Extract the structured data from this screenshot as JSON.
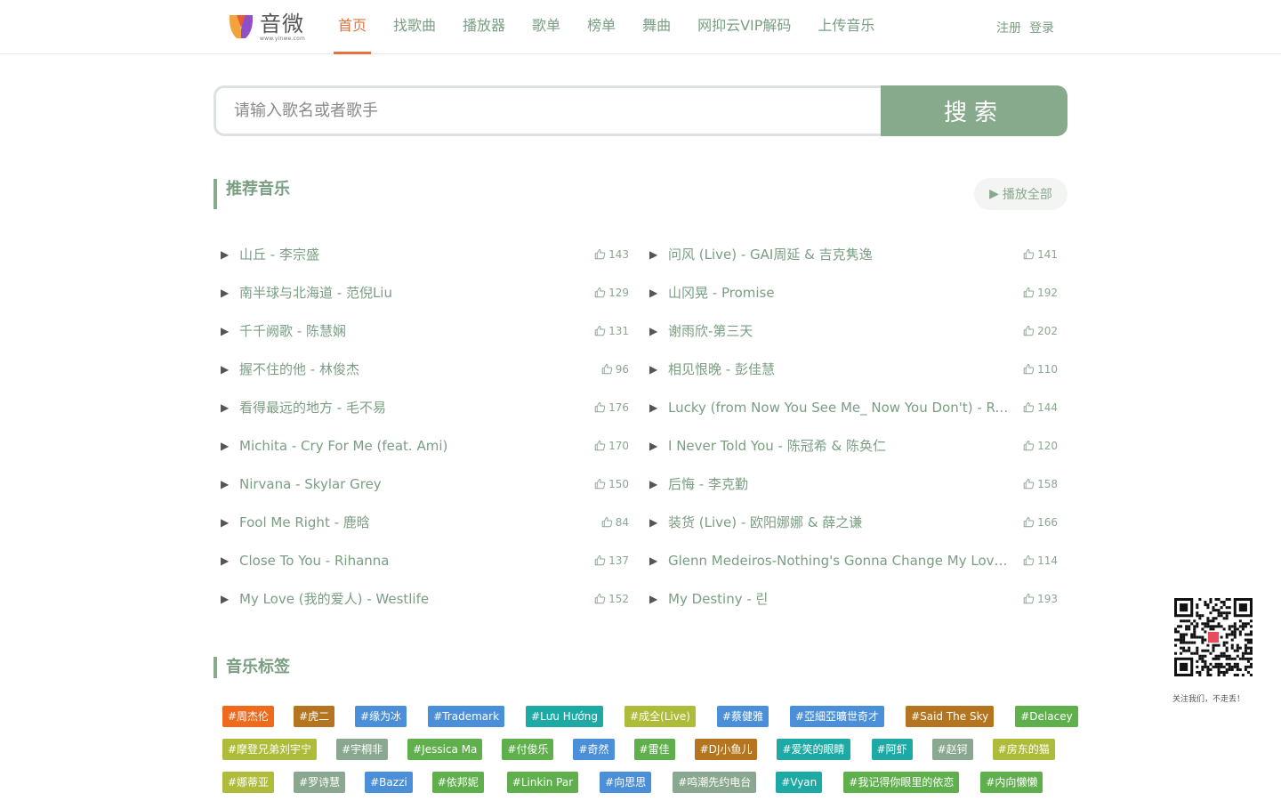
{
  "header": {
    "logo_text": "音微",
    "logo_sub": "www.yinwe.com",
    "nav": [
      {
        "label": "首页",
        "active": true
      },
      {
        "label": "找歌曲",
        "active": false
      },
      {
        "label": "播放器",
        "active": false
      },
      {
        "label": "歌单",
        "active": false
      },
      {
        "label": "榜单",
        "active": false
      },
      {
        "label": "舞曲",
        "active": false
      },
      {
        "label": "网抑云VIP解码",
        "active": false
      },
      {
        "label": "上传音乐",
        "active": false
      }
    ],
    "register": "注册",
    "login": "登录"
  },
  "search": {
    "placeholder": "请输入歌名或者歌手",
    "button": "搜索"
  },
  "recommend": {
    "title": "推荐音乐",
    "play_all": "播放全部",
    "left": [
      {
        "name": "山丘 - 李宗盛",
        "likes": "143"
      },
      {
        "name": "南半球与北海道 - 范倪Liu",
        "likes": "129"
      },
      {
        "name": "千千阙歌 - 陈慧娴",
        "likes": "131"
      },
      {
        "name": "握不住的他 - 林俊杰",
        "likes": "96"
      },
      {
        "name": "看得最远的地方 - 毛不易",
        "likes": "176"
      },
      {
        "name": "Michita - Cry For Me (feat. Ami)",
        "likes": "170"
      },
      {
        "name": "Nirvana - Skylar Grey",
        "likes": "150"
      },
      {
        "name": "Fool Me Right - 鹿晗",
        "likes": "84"
      },
      {
        "name": "Close To You - Rihanna",
        "likes": "137"
      },
      {
        "name": "My Love (我的爱人) - Westlife",
        "likes": "152"
      }
    ],
    "right": [
      {
        "name": "问风 (Live) - GAI周延 & 吉克隽逸",
        "likes": "141"
      },
      {
        "name": "山冈晃 - Promise",
        "likes": "192"
      },
      {
        "name": "谢雨欣-第三天",
        "likes": "202"
      },
      {
        "name": "相见恨晚 - 彭佳慧",
        "likes": "110"
      },
      {
        "name": "Lucky (from Now You See Me_ Now You Don't) - Reneé ...",
        "likes": "144"
      },
      {
        "name": "I Never Told You - 陈冠希 & 陈奂仁",
        "likes": "120"
      },
      {
        "name": "后悔 - 李克勤",
        "likes": "158"
      },
      {
        "name": "装货 (Live) - 欧阳娜娜 & 薛之谦",
        "likes": "166"
      },
      {
        "name": "Glenn Medeiros-Nothing's Gonna Change My Love For Y...",
        "likes": "114"
      },
      {
        "name": "My Destiny - 린",
        "likes": "193"
      }
    ]
  },
  "tags": {
    "title": "音乐标签",
    "rows": [
      [
        {
          "label": "#周杰伦",
          "color": "#f06a1d",
          "gap": 0
        },
        {
          "label": "#虎二",
          "color": "#b5741f",
          "gap": 22
        },
        {
          "label": "#缘为冰",
          "color": "#4a8fd8",
          "gap": 23
        },
        {
          "label": "#Trademark",
          "color": "#4a8fd8",
          "gap": 24
        },
        {
          "label": "#Lưu Hướng",
          "color": "#1eaaa4",
          "gap": 24
        },
        {
          "label": "#成全(Live)",
          "color": "#aebc3a",
          "gap": 24
        },
        {
          "label": "#蔡健雅",
          "color": "#4a8fd8",
          "gap": 24
        },
        {
          "label": "#亞細亞曠世奇才",
          "color": "#4a8fd8",
          "gap": 24
        },
        {
          "label": "#Said The Sky",
          "color": "#b5741f",
          "gap": 24
        },
        {
          "label": "#Delacey",
          "color": "#5fb04d",
          "gap": 24
        }
      ],
      [
        {
          "label": "#摩登兄弟刘宇宁",
          "color": "#aebc3a",
          "gap": 0
        },
        {
          "label": "#宇桐非",
          "color": "#8aa88f",
          "gap": 22
        },
        {
          "label": "#Jessica Ma",
          "color": "#5fb04d",
          "gap": 22
        },
        {
          "label": "#付俊乐",
          "color": "#5fb04d",
          "gap": 22
        },
        {
          "label": "#奇然",
          "color": "#4a8fd8",
          "gap": 22
        },
        {
          "label": "#雷佳",
          "color": "#5fb04d",
          "gap": 22
        },
        {
          "label": "#DJ小鱼儿",
          "color": "#b5741f",
          "gap": 22
        },
        {
          "label": "#爱笑的眼睛",
          "color": "#1eaaa4",
          "gap": 22
        },
        {
          "label": "#阿虾",
          "color": "#1eaaa4",
          "gap": 24
        },
        {
          "label": "#赵钶",
          "color": "#8aa88f",
          "gap": 22
        },
        {
          "label": "#房东的猫",
          "color": "#aebc3a",
          "gap": 22
        }
      ],
      [
        {
          "label": "#娜蒂亚",
          "color": "#aebc3a",
          "gap": 0
        },
        {
          "label": "#罗诗慧",
          "color": "#8aa88f",
          "gap": 22
        },
        {
          "label": "#Bazzi",
          "color": "#4a8fd8",
          "gap": 22
        },
        {
          "label": "#依邦妮",
          "color": "#5fb04d",
          "gap": 22
        },
        {
          "label": "#Linkin Par",
          "color": "#5fb04d",
          "gap": 26
        },
        {
          "label": "#向思思",
          "color": "#4a8fd8",
          "gap": 24
        },
        {
          "label": "#鸣潮先约电台",
          "color": "#8aa88f",
          "gap": 24
        },
        {
          "label": "#Vyan",
          "color": "#1eaaa4",
          "gap": 22
        },
        {
          "label": "#我记得你眼里的依恋",
          "color": "#5fb04d",
          "gap": 24
        },
        {
          "label": "#内向懒懒",
          "color": "#5fb04d",
          "gap": 24
        }
      ]
    ]
  },
  "qr": {
    "caption": "关注我们，不走丢！"
  },
  "colors": {
    "accent": "#e8713c",
    "text": "#7a9e82",
    "button": "#87a98c"
  }
}
